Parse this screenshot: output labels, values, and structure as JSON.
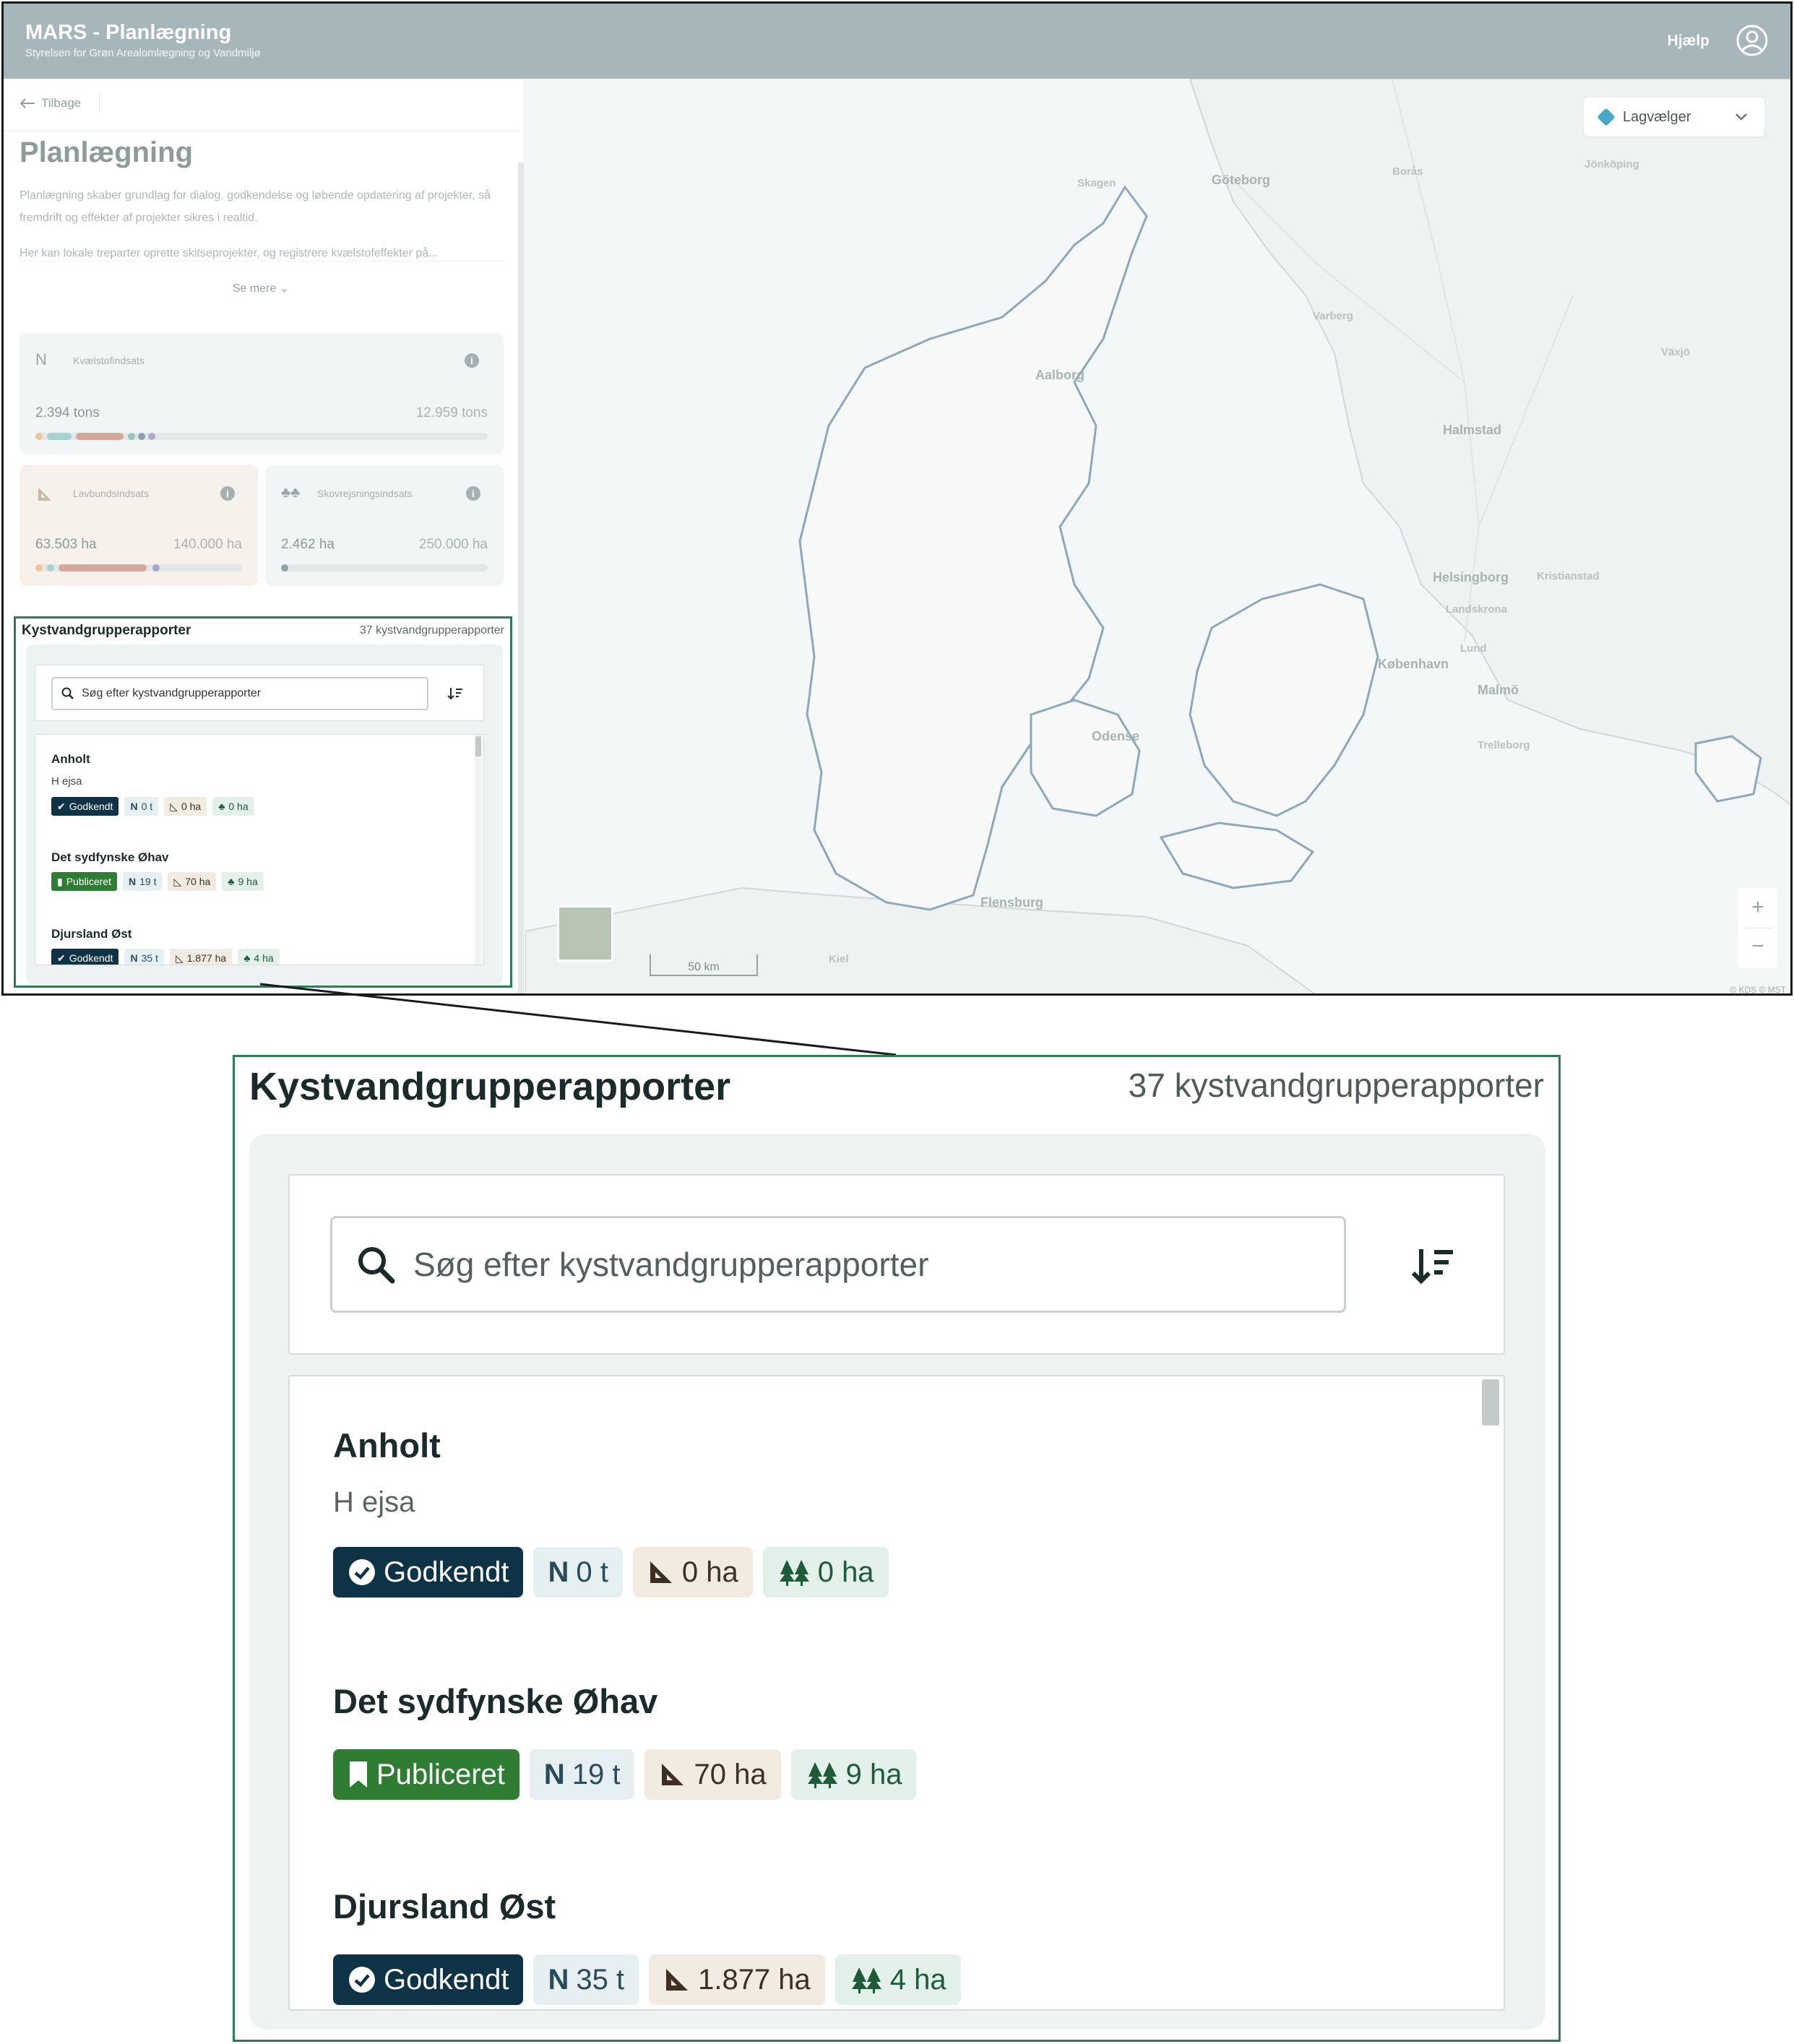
{
  "header": {
    "title": "MARS - Planlægning",
    "subtitle": "Styrelsen for Grøn Arealomlægning og Vandmiljø",
    "help": "Hjælp",
    "user_icon": "user-circle-icon"
  },
  "sidebar": {
    "back": "Tilbage",
    "page_title": "Planlægning",
    "desc1": "Planlægning skaber grundlag for dialog, godkendelse og løbende opdatering af projekter, så fremdrift og effekter af projekter sikres i realtid.",
    "desc2": "Her kan lokale treparter oprette skitseprojekter, og registrere kvælstofeffekter på...",
    "see_more": "Se mere",
    "cards": {
      "nitrogen": {
        "icon_letter": "N",
        "label": "Kvælstofindsats",
        "value": "2.394 tons",
        "max": "12.959 tons"
      },
      "lowland": {
        "label": "Lavbundsindsats",
        "value": "63.503 ha",
        "max": "140.000 ha"
      },
      "forest": {
        "label": "Skovrejsningsindsats",
        "value": "2.462 ha",
        "max": "250.000 ha"
      }
    }
  },
  "kyst": {
    "title": "Kystvandgrupperapporter",
    "count": "37 kystvandgrupperapporter",
    "search_placeholder": "Søg efter kystvandgrupperapporter",
    "items": [
      {
        "name": "Anholt",
        "sub": "H ejsa",
        "status": "Godkendt",
        "n": "0 t",
        "lav": "0 ha",
        "skov": "0 ha"
      },
      {
        "name": "Det sydfynske Øhav",
        "status": "Publiceret",
        "n": "19 t",
        "lav": "70 ha",
        "skov": "9 ha"
      },
      {
        "name": "Djursland Øst",
        "status": "Godkendt",
        "n": "35 t",
        "lav": "1.877 ha",
        "skov": "4 ha"
      }
    ]
  },
  "map": {
    "layer_picker": "Lagvælger",
    "zoom_in": "+",
    "zoom_out": "−",
    "scale": "50 km",
    "attribution": "© KDS © MST",
    "cities": [
      "Göteborg",
      "Borås",
      "Jönköping",
      "Varberg",
      "Växjö",
      "Halmstad",
      "Helsingborg",
      "København",
      "Malmö",
      "Lund",
      "Trelleborg",
      "Aalborg",
      "Odense",
      "Flensburg",
      "Kristianstad",
      "Landskrona",
      "Skagen",
      "Kiel"
    ]
  },
  "colors": {
    "topbar": "#a6b6bb",
    "accent_green": "#2f7a57",
    "approved": "#0f3346",
    "published": "#2e7d32"
  }
}
